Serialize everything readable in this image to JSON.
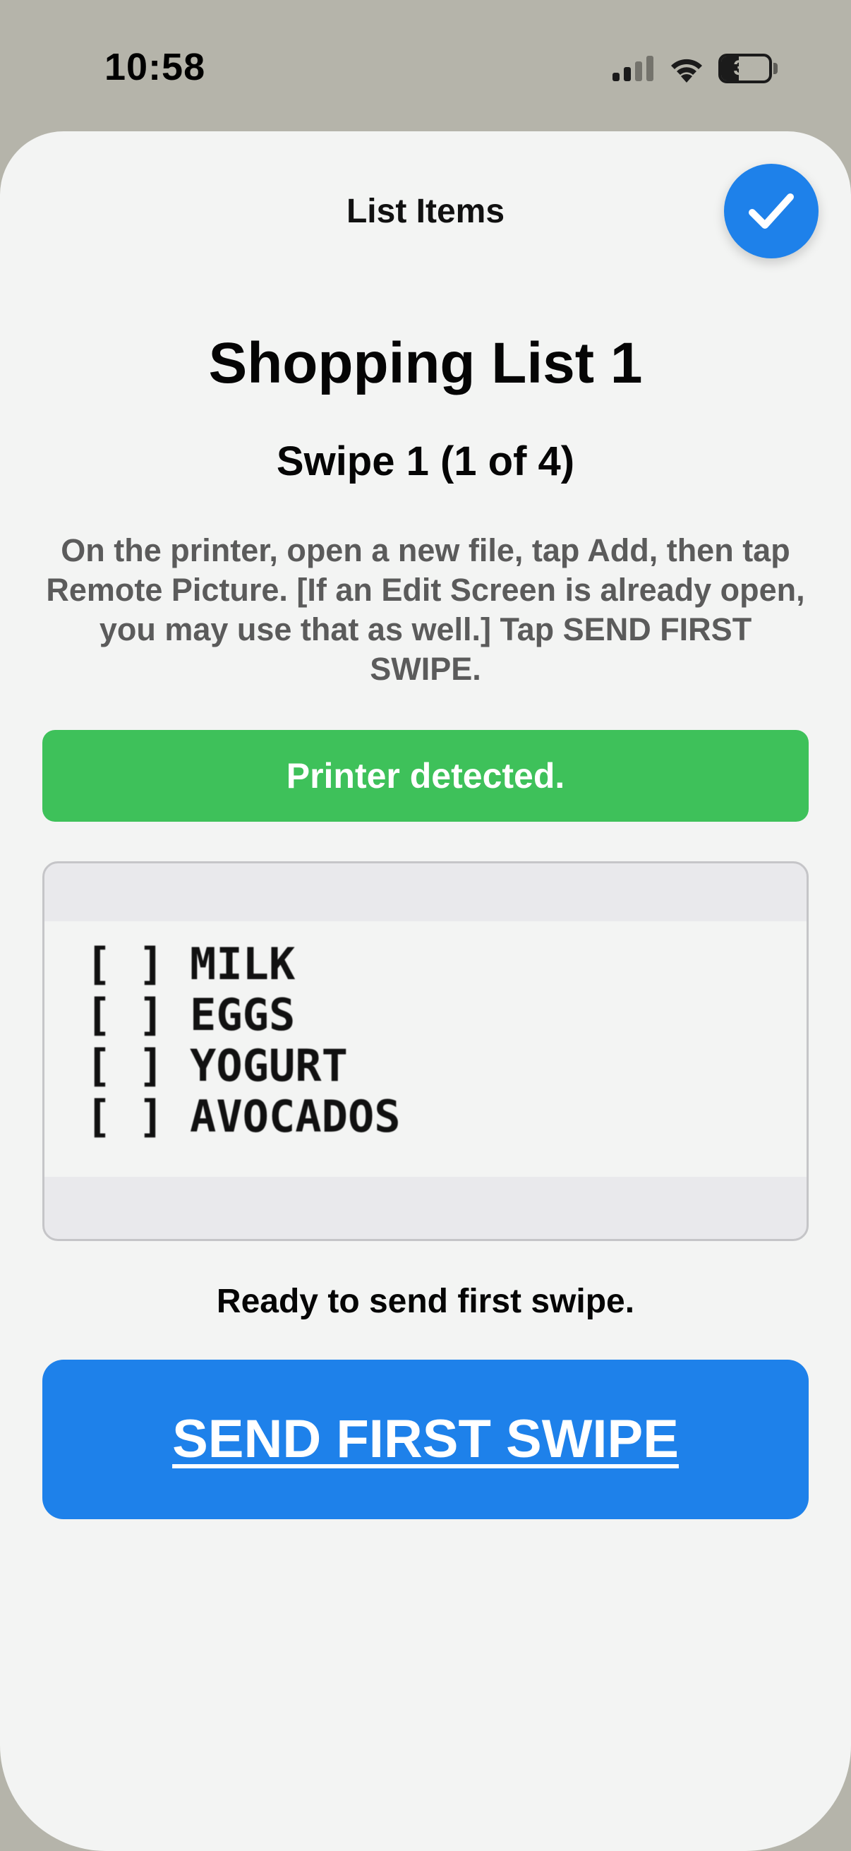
{
  "status_bar": {
    "time": "10:58",
    "battery_level": "37",
    "battery_fraction": 0.37,
    "icons": [
      "cellular-signal-icon",
      "wifi-icon",
      "battery-icon"
    ]
  },
  "header": {
    "title": "List Items",
    "done_icon": "checkmark-icon"
  },
  "list": {
    "title": "Shopping List 1",
    "swipe_label": "Swipe 1 (1 of 4)"
  },
  "instructions": "On the printer, open a new file, tap Add, then tap Remote Picture. [If an Edit Screen is already open, you may use that as well.] Tap SEND FIRST SWIPE.",
  "printer_status": "Printer detected.",
  "preview": {
    "items": [
      {
        "checkbox": "[ ]",
        "label": "MILK"
      },
      {
        "checkbox": "[ ]",
        "label": "EGGS"
      },
      {
        "checkbox": "[ ]",
        "label": "YOGURT"
      },
      {
        "checkbox": "[ ]",
        "label": "AVOCADOS"
      }
    ]
  },
  "status_message": "Ready to send first swipe.",
  "send_button_label": "SEND FIRST SWIPE",
  "colors": {
    "accent_blue": "#1e81ea",
    "success_green": "#3ec15a",
    "sheet_background": "#f3f4f3",
    "backdrop": "#b5b4aa"
  }
}
